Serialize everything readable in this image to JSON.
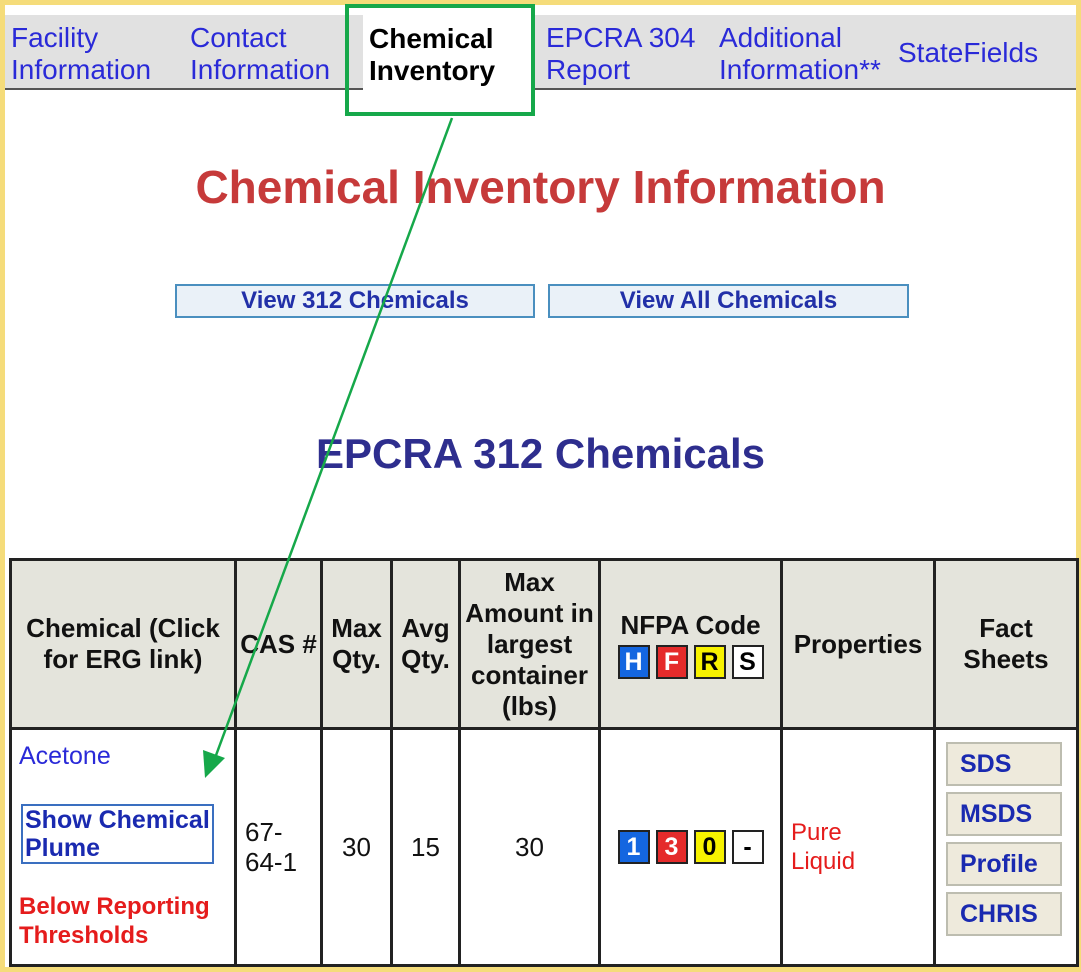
{
  "tabs": [
    {
      "line1": "Facility",
      "line2": "Information"
    },
    {
      "line1": "Contact",
      "line2": "Information"
    },
    {
      "line1": "Chemical",
      "line2": "Inventory"
    },
    {
      "line1": "EPCRA 304",
      "line2": "Report"
    },
    {
      "line1": "Additional",
      "line2": "Information**"
    },
    {
      "line1": "StateFields",
      "line2": ""
    }
  ],
  "main_title": "Chemical Inventory Information",
  "buttons": {
    "view312": "View 312 Chemicals",
    "viewAll": "View All Chemicals"
  },
  "section_title": "EPCRA 312 Chemicals",
  "table": {
    "headers": {
      "chemical": "Chemical (Click for ERG link)",
      "cas": "CAS #",
      "max": "Max Qty.",
      "avg": "Avg Qty.",
      "largest": "Max Amount in largest container (lbs)",
      "nfpa": "NFPA Code",
      "nfpa_letters": [
        "H",
        "F",
        "R",
        "S"
      ],
      "properties": "Properties",
      "fact": "Fact Sheets"
    },
    "row": {
      "chemical": "Acetone",
      "plume": "Show Chemical Plume",
      "status": "Below Reporting Thresholds",
      "cas": "67-64-1",
      "max": "30",
      "avg": "15",
      "largest": "30",
      "nfpa": [
        "1",
        "3",
        "0",
        "-"
      ],
      "properties": "Pure Liquid",
      "fact_sheets": [
        "SDS",
        "MSDS",
        "Profile",
        "CHRIS"
      ]
    }
  },
  "colors": {
    "frame": "#f5dc7a",
    "highlight": "#16a84a",
    "title": "#c63a3a",
    "section": "#2e2e8e"
  }
}
